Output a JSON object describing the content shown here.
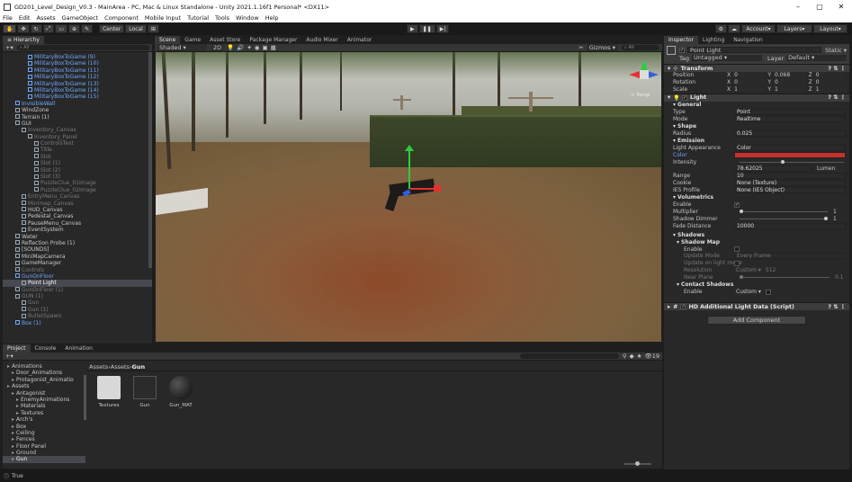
{
  "window": {
    "title": "GD201_Level_Design_V0.3 - MainArea - PC, Mac & Linux Standalone - Unity 2021.1.16f1 Personal* <DX11>"
  },
  "menu": [
    "File",
    "Edit",
    "Assets",
    "GameObject",
    "Component",
    "Mobile Input",
    "Tutorial",
    "Tools",
    "Window",
    "Help"
  ],
  "toolbar": {
    "pivot": "Center",
    "space": "Local",
    "account": "Account",
    "layers": "Layers",
    "layout": "Layout"
  },
  "hierarchy": {
    "tab": "Hierarchy",
    "search": "All",
    "rows": [
      {
        "t": "MilitaryBoxToGame (9)",
        "d": 4,
        "c": "blue"
      },
      {
        "t": "MilitaryBoxToGame (10)",
        "d": 4,
        "c": "blue"
      },
      {
        "t": "MilitaryBoxToGame (11)",
        "d": 4,
        "c": "blue"
      },
      {
        "t": "MilitaryBoxToGame (12)",
        "d": 4,
        "c": "blue"
      },
      {
        "t": "MilitaryBoxToGame (13)",
        "d": 4,
        "c": "blue"
      },
      {
        "t": "MilitaryBoxToGame (14)",
        "d": 4,
        "c": "blue"
      },
      {
        "t": "MilitaryBoxToGame (15)",
        "d": 4,
        "c": "blue"
      },
      {
        "t": "InvisibleWall",
        "d": 2,
        "c": "blue"
      },
      {
        "t": "WindZone",
        "d": 2,
        "c": ""
      },
      {
        "t": "Terrain (1)",
        "d": 2,
        "c": ""
      },
      {
        "t": "GUI",
        "d": 2,
        "c": ""
      },
      {
        "t": "Inventory_Canvas",
        "d": 3,
        "c": "dim"
      },
      {
        "t": "Inventory_Panel",
        "d": 4,
        "c": "dim"
      },
      {
        "t": "ControlsText",
        "d": 5,
        "c": "dim"
      },
      {
        "t": "Title",
        "d": 5,
        "c": "dim"
      },
      {
        "t": "Slot",
        "d": 5,
        "c": "dim"
      },
      {
        "t": "Slot (1)",
        "d": 5,
        "c": "dim"
      },
      {
        "t": "Slot (2)",
        "d": 5,
        "c": "dim"
      },
      {
        "t": "Slot (3)",
        "d": 5,
        "c": "dim"
      },
      {
        "t": "PuzzleClue_01Image",
        "d": 5,
        "c": "dim"
      },
      {
        "t": "PuzzleClue_02Image",
        "d": 5,
        "c": "dim"
      },
      {
        "t": "EntryMenu_Canvas",
        "d": 3,
        "c": "dim"
      },
      {
        "t": "Minimap_Canvas",
        "d": 3,
        "c": "dim"
      },
      {
        "t": "HUD_Canvas",
        "d": 3,
        "c": ""
      },
      {
        "t": "Pedestal_Canvas",
        "d": 3,
        "c": ""
      },
      {
        "t": "PauseMenu_Canvas",
        "d": 3,
        "c": ""
      },
      {
        "t": "EventSystem",
        "d": 3,
        "c": ""
      },
      {
        "t": "Water",
        "d": 2,
        "c": ""
      },
      {
        "t": "Reflection Probe (1)",
        "d": 2,
        "c": ""
      },
      {
        "t": "[SOUNDS]",
        "d": 2,
        "c": ""
      },
      {
        "t": "MiniMapCamera",
        "d": 2,
        "c": ""
      },
      {
        "t": "GameManager",
        "d": 2,
        "c": ""
      },
      {
        "t": "Controls",
        "d": 2,
        "c": "dim"
      },
      {
        "t": "GunOnFloor",
        "d": 2,
        "c": "blue"
      },
      {
        "t": "Point Light",
        "d": 3,
        "c": "sel"
      },
      {
        "t": "GunOnFloor (1)",
        "d": 2,
        "c": "dim"
      },
      {
        "t": "GUN (1)",
        "d": 2,
        "c": "dim"
      },
      {
        "t": "Gun",
        "d": 3,
        "c": "dim"
      },
      {
        "t": "Gun (1)",
        "d": 3,
        "c": "dim"
      },
      {
        "t": "BulletSpawn",
        "d": 3,
        "c": "dim"
      },
      {
        "t": "Box (1)",
        "d": 2,
        "c": "blue"
      }
    ]
  },
  "sceneTabs": [
    "Scene",
    "Game",
    "Asset Store",
    "Package Manager",
    "Audio Mixer",
    "Animator"
  ],
  "scene": {
    "shading": "Shaded",
    "mode2d": "2D",
    "gizmos": "Gizmos",
    "search": "All",
    "persp": "< Persp"
  },
  "project": {
    "tabs": [
      "Project",
      "Console",
      "Animation"
    ],
    "count": "19",
    "breadcrumb": [
      "Assets",
      "Assets",
      "Gun"
    ],
    "tree": [
      {
        "t": "Animations",
        "d": 1
      },
      {
        "t": "Door_Animations",
        "d": 2
      },
      {
        "t": "Protagonist_Animatio",
        "d": 2
      },
      {
        "t": "Assets",
        "d": 1
      },
      {
        "t": "Antagonist",
        "d": 2
      },
      {
        "t": "EnemyAnimations",
        "d": 3
      },
      {
        "t": "Materials",
        "d": 3
      },
      {
        "t": "Textures",
        "d": 3
      },
      {
        "t": "Arch's",
        "d": 2
      },
      {
        "t": "Box",
        "d": 2
      },
      {
        "t": "Ceiling",
        "d": 2
      },
      {
        "t": "Fences",
        "d": 2
      },
      {
        "t": "Floor Panel",
        "d": 2
      },
      {
        "t": "Ground",
        "d": 2
      },
      {
        "t": "Gun",
        "d": 2
      }
    ],
    "assets": [
      {
        "name": "Textures",
        "kind": "folder"
      },
      {
        "name": "Gun",
        "kind": "model"
      },
      {
        "name": "Gun_MAT",
        "kind": "material"
      }
    ]
  },
  "inspector": {
    "tabs": [
      "Inspector",
      "Lighting",
      "Navigation"
    ],
    "name": "Point Light",
    "static": "Static",
    "tagLabel": "Tag",
    "tag": "Untagged",
    "layerLabel": "Layer",
    "layer": "Default",
    "transform": {
      "title": "Transform",
      "position": {
        "label": "Position",
        "x": "0",
        "y": "0.068",
        "z": "0"
      },
      "rotation": {
        "label": "Rotation",
        "x": "0",
        "y": "0",
        "z": "0"
      },
      "scale": {
        "label": "Scale",
        "x": "1",
        "y": "1",
        "z": "1"
      }
    },
    "light": {
      "title": "Light",
      "general": "General",
      "typeLabel": "Type",
      "type": "Point",
      "modeLabel": "Mode",
      "mode": "Realtime",
      "shape": "Shape",
      "radiusLabel": "Radius",
      "radius": "0.025",
      "emission": "Emission",
      "appearanceLabel": "Light Appearance",
      "appearance": "Color",
      "colorLabel": "Color",
      "color": "#c8302c",
      "intensityLabel": "Intensity",
      "intensity": "78.62025",
      "intensityUnit": "Lumen",
      "rangeLabel": "Range",
      "range": "10",
      "cookieLabel": "Cookie",
      "cookie": "None (Texture)",
      "iesLabel": "IES Profile",
      "ies": "None (IES Object)",
      "volumetrics": "Volumetrics",
      "enableLabel": "Enable",
      "multiplierLabel": "Multiplier",
      "multiplier": "1",
      "dimmerLabel": "Shadow Dimmer",
      "dimmer": "1",
      "fadeLabel": "Fade Distance",
      "fade": "10000",
      "shadows": "Shadows",
      "shadowMap": "Shadow Map",
      "smEnable": "Enable",
      "updateModeLabel": "Update Mode",
      "updateMode": "Every Frame",
      "updateOnMoveLabel": "Update on light move",
      "resolutionLabel": "Resolution",
      "resolution": "Custom",
      "resolutionVal": "512",
      "nearPlaneLabel": "Near Plane",
      "nearPlane": "0.1",
      "contactShadows": "Contact Shadows",
      "csEnable": "Enable",
      "csValue": "Custom"
    },
    "hdData": "HD Additional Light Data (Script)",
    "addComponent": "Add Component"
  },
  "status": {
    "text": "True"
  }
}
